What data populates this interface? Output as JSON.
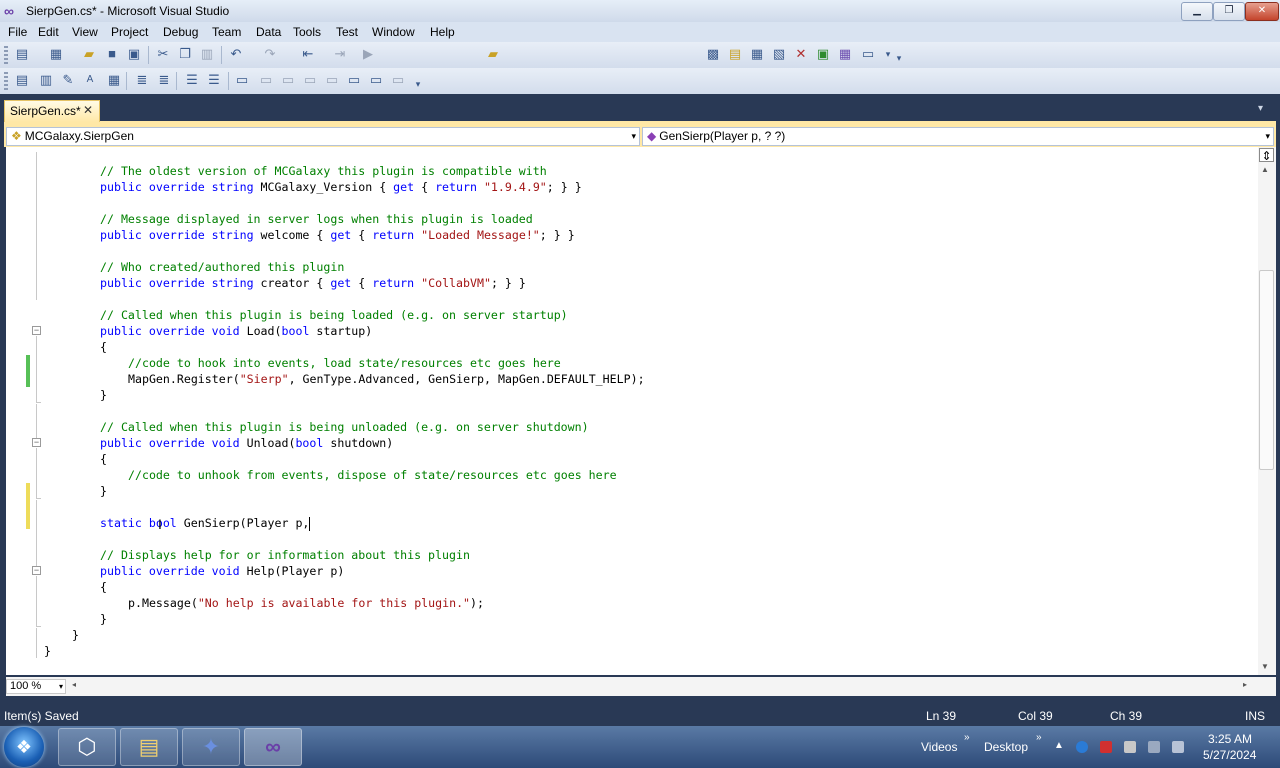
{
  "window": {
    "title": "SierpGen.cs* - Microsoft Visual Studio",
    "icon": "vs-infinity-icon"
  },
  "menu": [
    "File",
    "Edit",
    "View",
    "Project",
    "Debug",
    "Team",
    "Data",
    "Tools",
    "Test",
    "Window",
    "Help"
  ],
  "doc_tab": {
    "label": "SierpGen.cs*",
    "close": "✕"
  },
  "nav": {
    "class_combo": "MCGalaxy.SierpGen",
    "member_combo": "GenSierp(Player p, ? ?)"
  },
  "code_lines": [
    "// The oldest version of MCGalaxy this plugin is compatible with",
    "public override string MCGalaxy_Version { get { return \"1.9.4.9\"; } }",
    "// Message displayed in server logs when this plugin is loaded",
    "public override string welcome { get { return \"Loaded Message!\"; } }",
    "// Who created/authored this plugin",
    "public override string creator { get { return \"CollabVM\"; } }",
    "// Called when this plugin is being loaded (e.g. on server startup)",
    "public override void Load(bool startup)",
    "{",
    "//code to hook into events, load state/resources etc goes here",
    "MapGen.Register(\"Sierp\", GenType.Advanced, GenSierp, MapGen.DEFAULT_HELP);",
    "}",
    "// Called when this plugin is being unloaded (e.g. on server shutdown)",
    "public override void Unload(bool shutdown)",
    "{",
    "//code to unhook from events, dispose of state/resources etc goes here",
    "}",
    "static bool GenSierp(Player p,",
    "// Displays help for or information about this plugin",
    "public override void Help(Player p)",
    "{",
    "p.Message(\"No help is available for this plugin.\");",
    "}",
    "}",
    "}"
  ],
  "zoom": "100 %",
  "status": {
    "message": "Item(s) Saved",
    "ln": "Ln 39",
    "col": "Col 39",
    "ch": "Ch 39",
    "mode": "INS"
  },
  "taskbar": {
    "tray_videos": "Videos",
    "tray_desktop": "Desktop",
    "time": "3:25 AM",
    "date": "5/27/2024"
  },
  "colors": {
    "keyword": "#0000ff",
    "comment": "#008000",
    "string": "#a31515",
    "change_saved": "#57c057",
    "change_unsaved": "#eedc5a"
  }
}
